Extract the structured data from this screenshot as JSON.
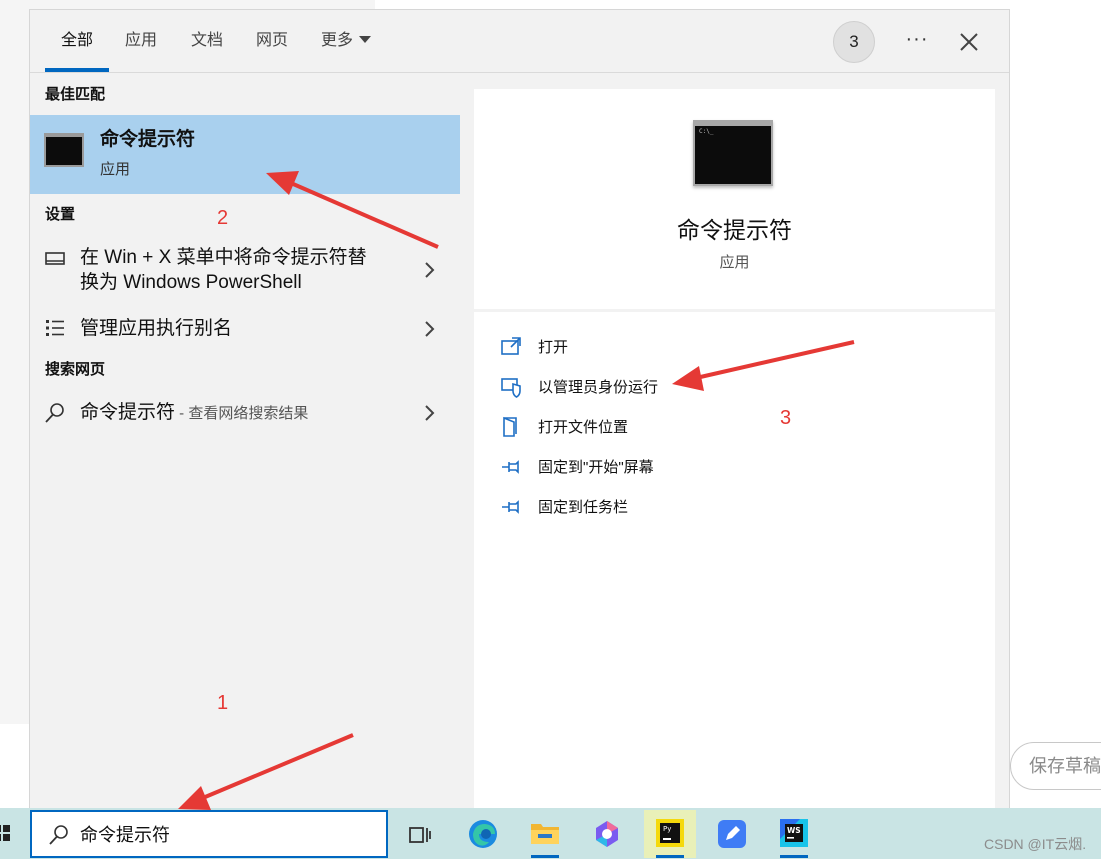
{
  "tabs": [
    {
      "label": "全部",
      "active": true
    },
    {
      "label": "应用"
    },
    {
      "label": "文档"
    },
    {
      "label": "网页"
    },
    {
      "label": "更多"
    }
  ],
  "header": {
    "badge": "3",
    "more_dots": "···"
  },
  "sections": {
    "best_match": "最佳匹配",
    "settings": "设置",
    "web": "搜索网页"
  },
  "best_match": {
    "title": "命令提示符",
    "subtitle": "应用",
    "icon": "command-prompt-icon"
  },
  "settings_items": [
    {
      "label_line1": "在 Win + X 菜单中将命令提示符替",
      "label_line2": "换为 Windows PowerShell",
      "icon": "monitor-icon"
    },
    {
      "label": "管理应用执行别名",
      "icon": "list-icon"
    }
  ],
  "web_item": {
    "label": "命令提示符",
    "sub": " - 查看网络搜索结果",
    "icon": "search-icon"
  },
  "preview": {
    "title": "命令提示符",
    "subtitle": "应用"
  },
  "actions": [
    {
      "label": "打开",
      "icon": "open-icon"
    },
    {
      "label": "以管理员身份运行",
      "icon": "shield-icon"
    },
    {
      "label": "打开文件位置",
      "icon": "folder-icon"
    },
    {
      "label": "固定到\"开始\"屏幕",
      "icon": "pin-icon"
    },
    {
      "label": "固定到任务栏",
      "icon": "pin-icon"
    }
  ],
  "taskbar": {
    "search_value": "命令提示符",
    "apps": [
      "task-view-icon",
      "edge-icon",
      "file-explorer-icon",
      "copilot-icon",
      "pycharm-icon",
      "feishu-icon",
      "webstorm-icon"
    ],
    "watermark": "CSDN @IT云烟."
  },
  "background": {
    "save_draft": "保存草稿"
  },
  "annotations": {
    "n1": "1",
    "n2": "2",
    "n3": "3"
  },
  "colors": {
    "accent": "#0067c0",
    "selection": "#a9d0ee",
    "annotation": "#e53935",
    "taskbar": "#c9e4e4"
  }
}
